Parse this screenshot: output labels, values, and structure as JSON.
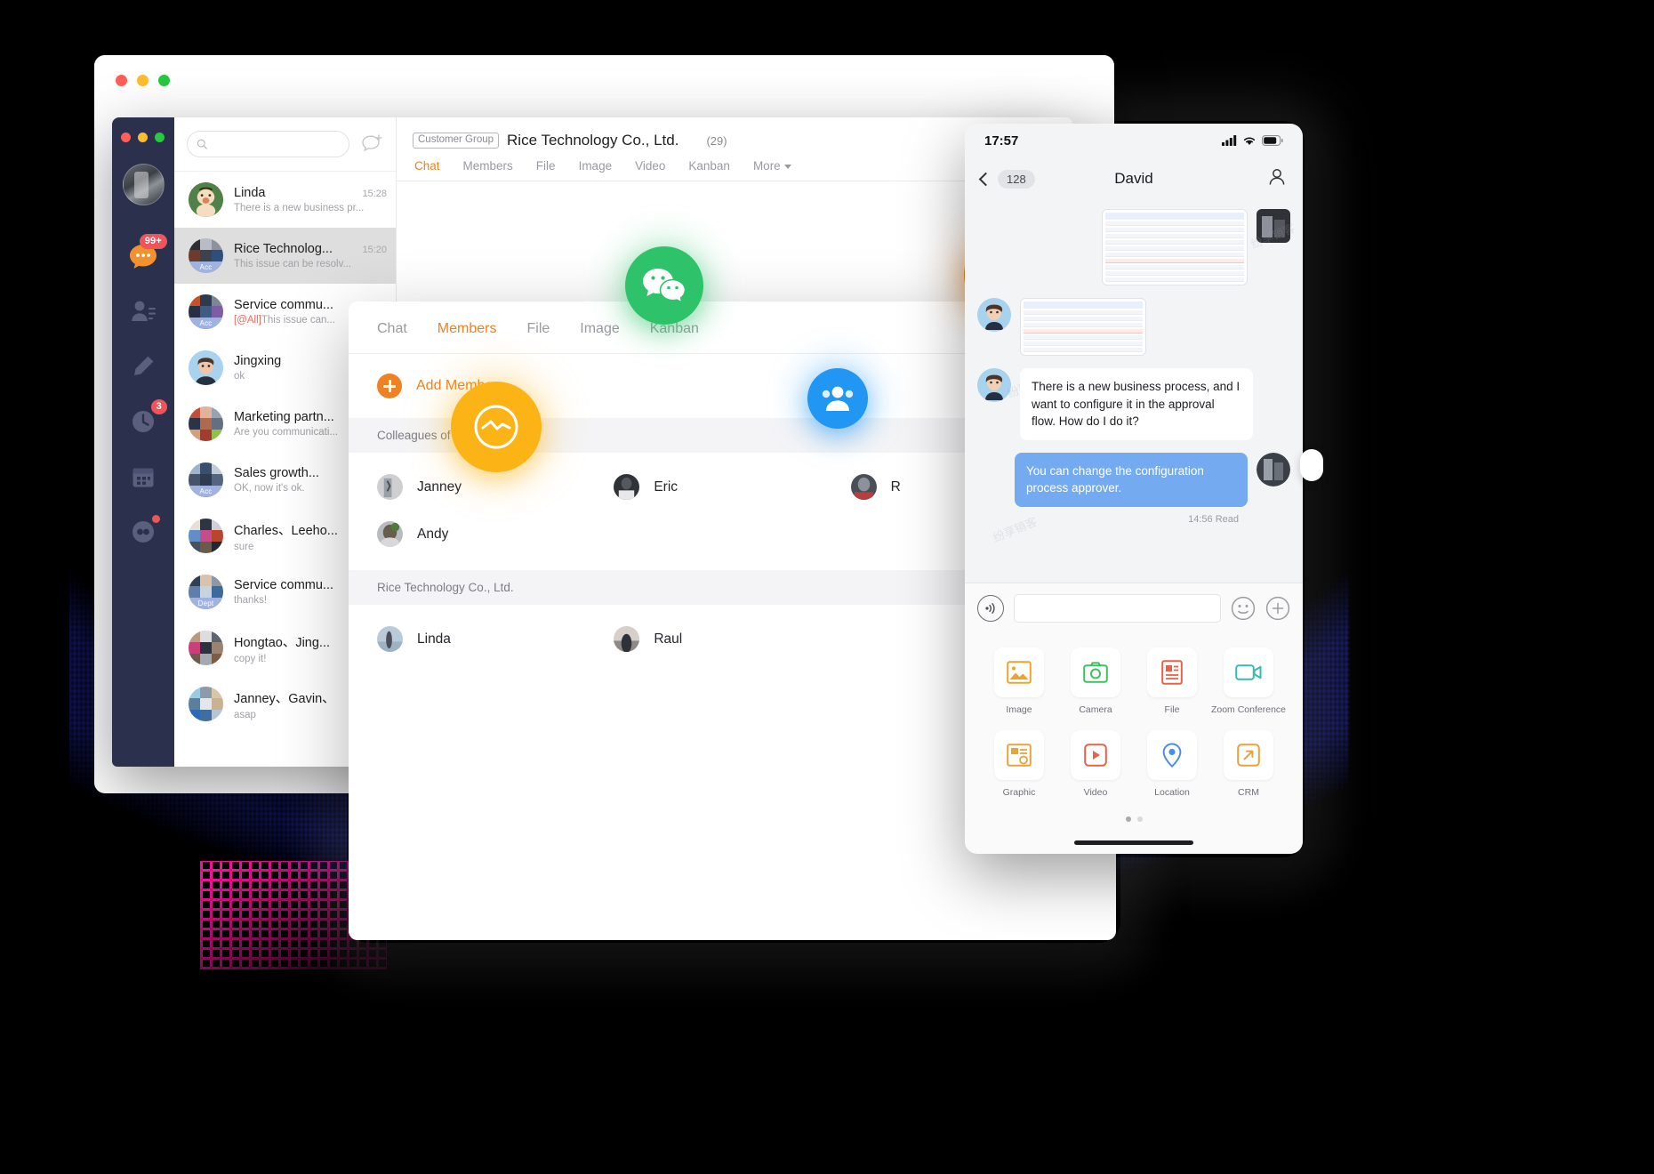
{
  "window": {
    "traffic_lights": [
      "close",
      "minimize",
      "maximize"
    ]
  },
  "search": {
    "placeholder": "",
    "value": ""
  },
  "rail": {
    "items": [
      {
        "name": "chats-icon",
        "badge": "99+"
      },
      {
        "name": "contacts-icon",
        "badge": ""
      },
      {
        "name": "compose-icon",
        "badge": ""
      },
      {
        "name": "history-icon",
        "badge": "3"
      },
      {
        "name": "calendar-icon",
        "badge": ""
      },
      {
        "name": "apps-icon",
        "badge": "dot"
      }
    ]
  },
  "chat_list": [
    {
      "name": "Linda",
      "time": "15:28",
      "preview": "There is a new business pr...",
      "tag": "",
      "at_all": "",
      "active": false
    },
    {
      "name": "Rice Technolog...",
      "time": "15:20",
      "preview": "This issue can be resolv...",
      "tag": "Acc",
      "at_all": "",
      "active": true
    },
    {
      "name": "Service commu...",
      "time": "",
      "preview": "This issue can...",
      "tag": "Acc",
      "at_all": "[@All]",
      "active": false
    },
    {
      "name": "Jingxing",
      "time": "",
      "preview": "ok",
      "tag": "",
      "at_all": "",
      "active": false
    },
    {
      "name": "Marketing partn...",
      "time": "",
      "preview": "Are you communicati...",
      "tag": "",
      "at_all": "",
      "active": false
    },
    {
      "name": "Sales growth...",
      "time": "",
      "preview": "OK, now it's ok.",
      "tag": "Acc",
      "at_all": "",
      "active": false
    },
    {
      "name": "Charles、Leeho...",
      "time": "",
      "preview": "sure",
      "tag": "",
      "at_all": "",
      "active": false
    },
    {
      "name": "Service commu...",
      "time": "",
      "preview": "thanks!",
      "tag": "Dept",
      "at_all": "",
      "active": false
    },
    {
      "name": "Hongtao、Jing...",
      "time": "",
      "preview": "copy it!",
      "tag": "",
      "at_all": "",
      "active": false
    },
    {
      "name": "Janney、Gavin、",
      "time": "",
      "preview": "asap",
      "tag": "",
      "at_all": "",
      "active": false
    }
  ],
  "conversation": {
    "group_chip": "Customer Group",
    "title": "Rice Technology Co., Ltd.",
    "member_count": "(29)",
    "tabs": [
      {
        "label": "Chat",
        "active": true
      },
      {
        "label": "Members",
        "active": false
      },
      {
        "label": "File",
        "active": false
      },
      {
        "label": "Image",
        "active": false
      },
      {
        "label": "Video",
        "active": false
      },
      {
        "label": "Kanban",
        "active": false
      },
      {
        "label": "More",
        "active": false,
        "has_caret": true
      }
    ]
  },
  "modal": {
    "tabs": [
      {
        "label": "Chat",
        "active": false
      },
      {
        "label": "Members",
        "active": true
      },
      {
        "label": "File",
        "active": false
      },
      {
        "label": "Image",
        "active": false
      },
      {
        "label": "Kanban",
        "active": false
      }
    ],
    "add_members_label": "Add Members",
    "sections": [
      {
        "heading": "Colleagues of",
        "members": [
          {
            "name": "Janney"
          },
          {
            "name": "Eric"
          },
          {
            "name": "R"
          },
          {
            "name": "Andy"
          }
        ]
      },
      {
        "heading": "Rice Technology Co., Ltd.",
        "members": [
          {
            "name": "Linda"
          },
          {
            "name": "Raul"
          }
        ]
      }
    ]
  },
  "bubbles": [
    {
      "name": "wechat-bubble",
      "color": "#2ec36a",
      "icon": "wechat-icon"
    },
    {
      "name": "yellow-bubble",
      "color": "#fcb316",
      "icon": "pulse-icon"
    },
    {
      "name": "blue-bubble",
      "color": "#2196f3",
      "icon": "group-icon"
    },
    {
      "name": "orange-bubble",
      "color": "#f7841a",
      "icon": "bookmark-icon"
    }
  ],
  "phone": {
    "status_time": "17:57",
    "back_count": "128",
    "title": "David",
    "watermark": "纷享销客",
    "messages": [
      {
        "type": "image",
        "side": "them",
        "caption": ""
      },
      {
        "type": "image",
        "side": "them",
        "caption": ""
      },
      {
        "type": "text",
        "side": "them",
        "text": "There is a new business process, and I want to configure it in the approval flow. How do I do it?"
      },
      {
        "type": "text",
        "side": "me",
        "text": "You can change the configuration process approver."
      }
    ],
    "read_receipt": "14:56 Read",
    "composer": {
      "placeholder": "",
      "value": ""
    },
    "panel": [
      {
        "label": "Image",
        "icon": "image-icon",
        "color": "#f0a32a"
      },
      {
        "label": "Camera",
        "icon": "camera-icon",
        "color": "#3fbf62"
      },
      {
        "label": "File",
        "icon": "file-icon",
        "color": "#e8624a"
      },
      {
        "label": "Zoom Conference",
        "icon": "video-camera-icon",
        "color": "#35bcb0"
      },
      {
        "label": "Graphic",
        "icon": "graphic-icon",
        "color": "#e8a33d"
      },
      {
        "label": "Video",
        "icon": "video-icon",
        "color": "#e8624a"
      },
      {
        "label": "Location",
        "icon": "location-icon",
        "color": "#4a90e2"
      },
      {
        "label": "CRM",
        "icon": "crm-icon",
        "color": "#e8a33d"
      }
    ],
    "page_dots": 2,
    "active_page": 1
  },
  "colors": {
    "accent_orange": "#f08122",
    "rail_dark": "#2b304d",
    "badge_red": "#f0545b",
    "mine_bubble": "#74aaf0"
  }
}
